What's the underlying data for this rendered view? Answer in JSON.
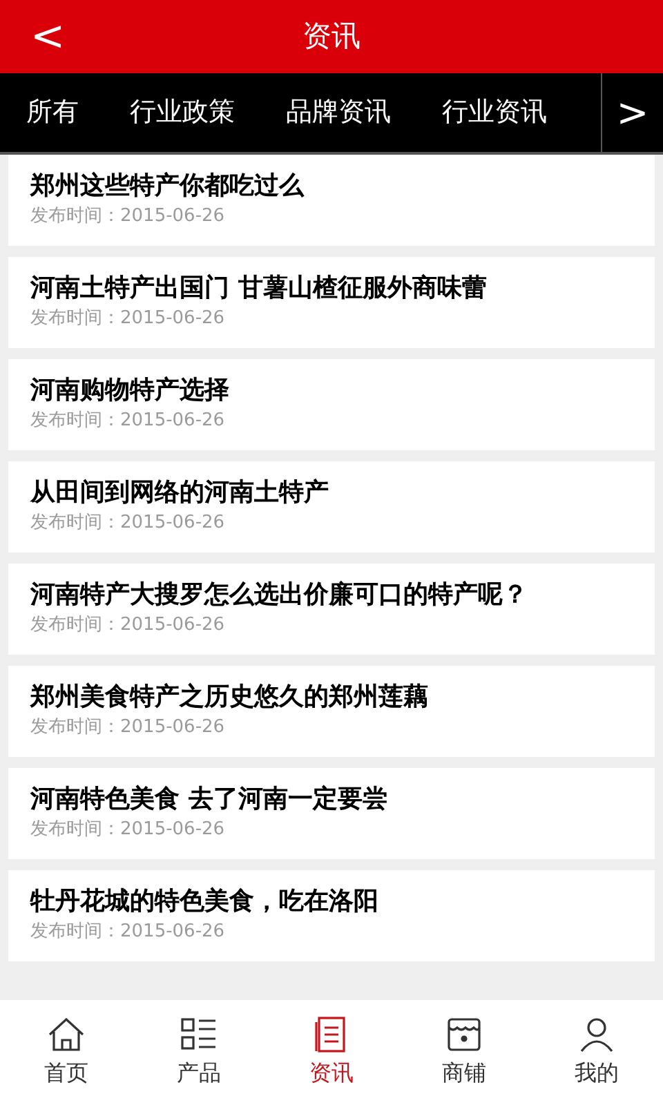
{
  "header": {
    "back": "<",
    "title": "资讯"
  },
  "categories": {
    "items": [
      {
        "label": "所有"
      },
      {
        "label": "行业政策"
      },
      {
        "label": "品牌资讯"
      },
      {
        "label": "行业资讯"
      }
    ],
    "more": ">"
  },
  "articles": [
    {
      "title": "郑州这些特产你都吃过么",
      "date": "发布时间：2015-06-26"
    },
    {
      "title": "河南土特产出国门 甘薯山楂征服外商味蕾",
      "date": "发布时间：2015-06-26"
    },
    {
      "title": "河南购物特产选择",
      "date": "发布时间：2015-06-26"
    },
    {
      "title": "从田间到网络的河南土特产",
      "date": "发布时间：2015-06-26"
    },
    {
      "title": "河南特产大搜罗怎么选出价廉可口的特产呢？",
      "date": "发布时间：2015-06-26"
    },
    {
      "title": "郑州美食特产之历史悠久的郑州莲藕",
      "date": "发布时间：2015-06-26"
    },
    {
      "title": "河南特色美食 去了河南一定要尝",
      "date": "发布时间：2015-06-26"
    },
    {
      "title": "牡丹花城的特色美食，吃在洛阳",
      "date": "发布时间：2015-06-26"
    }
  ],
  "bottom_nav": [
    {
      "kind": "home",
      "label": "首页",
      "selected": false
    },
    {
      "kind": "products",
      "label": "产品",
      "selected": false
    },
    {
      "kind": "news",
      "label": "资讯",
      "selected": true
    },
    {
      "kind": "shop",
      "label": "商铺",
      "selected": false
    },
    {
      "kind": "profile",
      "label": "我的",
      "selected": false
    }
  ]
}
